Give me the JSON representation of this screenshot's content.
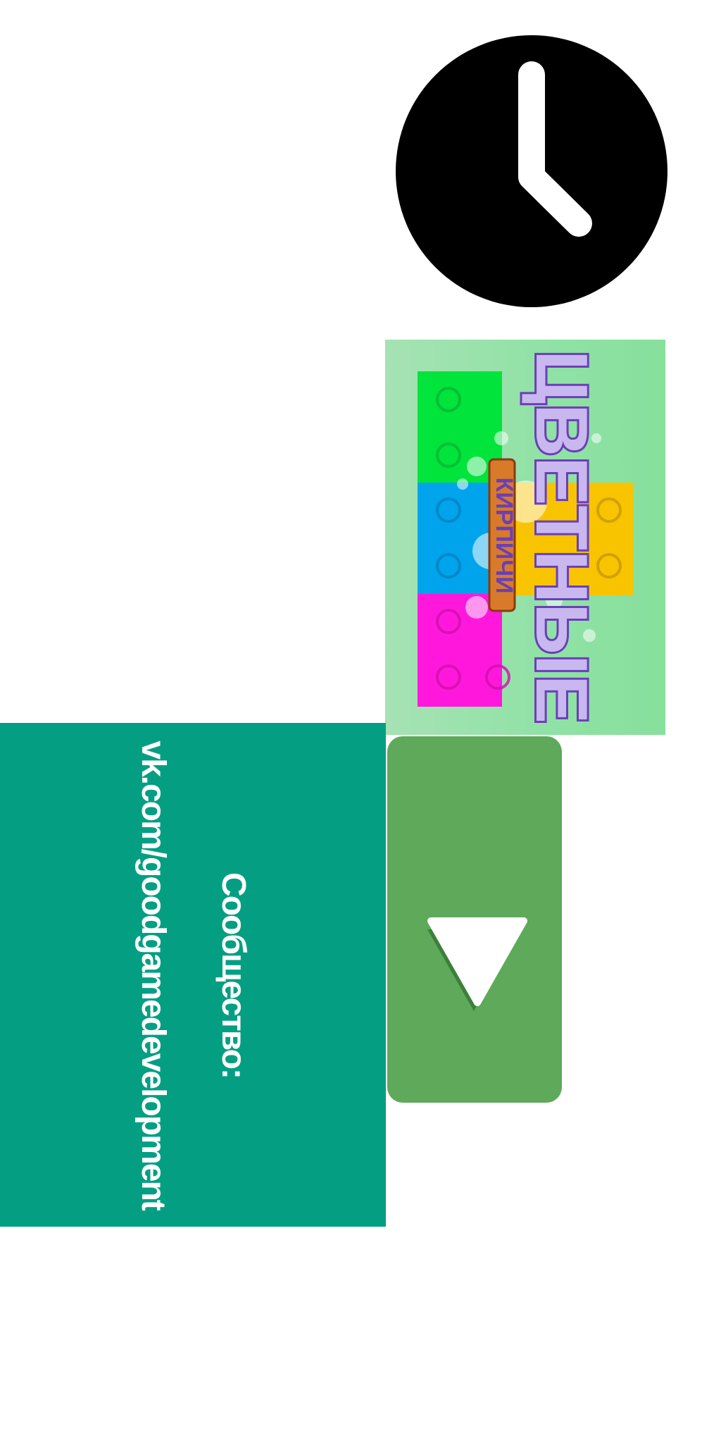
{
  "clock": {
    "icon": "clock-icon",
    "color": "#000000"
  },
  "logo": {
    "title": "ЦВЕТНЫЕ",
    "subtitle": "КИРПИЧИ",
    "background": "#8fe2a5",
    "brick_colors": [
      "#00e43c",
      "#00a4ec",
      "#ff18dc",
      "#f8c400"
    ],
    "text_color": "#6a3fb6"
  },
  "play_button": {
    "icon": "triangle-down-icon",
    "color": "#5ea95a"
  },
  "community": {
    "label": "Сообщество:",
    "link": "vk.com/goodgamedevelopment",
    "background": "#049f83"
  }
}
